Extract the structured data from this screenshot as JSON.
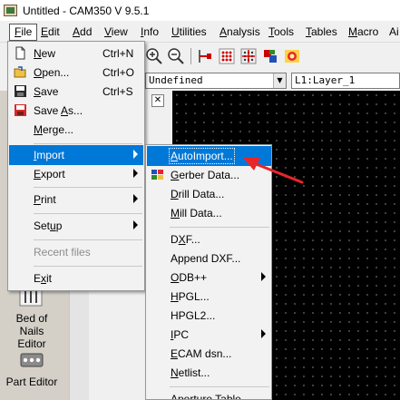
{
  "window": {
    "title": "Untitled - CAM350 V 9.5.1"
  },
  "menubar": {
    "items": [
      {
        "label": "File",
        "mnemonic": "F",
        "rest": "ile"
      },
      {
        "label": "Edit",
        "mnemonic": "E",
        "rest": "dit"
      },
      {
        "label": "Add",
        "mnemonic": "A",
        "rest": "dd"
      },
      {
        "label": "View",
        "mnemonic": "V",
        "rest": "iew"
      },
      {
        "label": "Info",
        "mnemonic": "I",
        "rest": "nfo"
      },
      {
        "label": "Utilities",
        "mnemonic": "U",
        "rest": "tilities"
      },
      {
        "label": "Analysis",
        "mnemonic": "A",
        "rest": "nalysis"
      },
      {
        "label": "Tools",
        "mnemonic": "T",
        "rest": "ools"
      },
      {
        "label": "Tables",
        "mnemonic": "T",
        "rest": "ables"
      },
      {
        "label": "Macro",
        "mnemonic": "M",
        "rest": "acro"
      },
      {
        "label": "Ai",
        "mnemonic": "",
        "rest": "Ai"
      }
    ]
  },
  "selectors": {
    "dcode": "Undefined",
    "layer": "L1:Layer_1"
  },
  "file_menu": {
    "items": [
      {
        "label_pre": "",
        "mnemonic": "N",
        "label_post": "ew",
        "shortcut": "Ctrl+N",
        "icon": "new-file-icon"
      },
      {
        "label_pre": "",
        "mnemonic": "O",
        "label_post": "pen...",
        "shortcut": "Ctrl+O",
        "icon": "open-folder-icon"
      },
      {
        "label_pre": "",
        "mnemonic": "S",
        "label_post": "ave",
        "shortcut": "Ctrl+S",
        "icon": "save-disk-icon"
      },
      {
        "label_pre": "Save ",
        "mnemonic": "A",
        "label_post": "s...",
        "shortcut": "",
        "icon": "save-as-icon"
      },
      {
        "label_pre": "",
        "mnemonic": "M",
        "label_post": "erge...",
        "shortcut": "",
        "icon": ""
      },
      {
        "label_pre": "",
        "mnemonic": "I",
        "label_post": "mport",
        "shortcut": "",
        "icon": ""
      },
      {
        "label_pre": "",
        "mnemonic": "E",
        "label_post": "xport",
        "shortcut": "",
        "icon": ""
      },
      {
        "label_pre": "",
        "mnemonic": "P",
        "label_post": "rint",
        "shortcut": "",
        "icon": ""
      },
      {
        "label_pre": "Set",
        "mnemonic": "u",
        "label_post": "p",
        "shortcut": "",
        "icon": ""
      },
      {
        "label_pre": "Recent files",
        "mnemonic": "",
        "label_post": "",
        "shortcut": "",
        "icon": ""
      },
      {
        "label_pre": "E",
        "mnemonic": "x",
        "label_post": "it",
        "shortcut": "",
        "icon": ""
      }
    ]
  },
  "import_menu": {
    "items": [
      {
        "label_pre": "",
        "mnemonic": "A",
        "label_post": "utoImport..."
      },
      {
        "label_pre": "",
        "mnemonic": "G",
        "label_post": "erber Data..."
      },
      {
        "label_pre": "",
        "mnemonic": "D",
        "label_post": "rill Data..."
      },
      {
        "label_pre": "",
        "mnemonic": "M",
        "label_post": "ill Data..."
      },
      {
        "label_pre": "D",
        "mnemonic": "X",
        "label_post": "F..."
      },
      {
        "label_pre": "Append DXF...",
        "mnemonic": "",
        "label_post": ""
      },
      {
        "label_pre": "",
        "mnemonic": "O",
        "label_post": "DB++"
      },
      {
        "label_pre": "",
        "mnemonic": "H",
        "label_post": "PGL..."
      },
      {
        "label_pre": "HPGL2...",
        "mnemonic": "",
        "label_post": ""
      },
      {
        "label_pre": "",
        "mnemonic": "I",
        "label_post": "PC"
      },
      {
        "label_pre": "",
        "mnemonic": "E",
        "label_post": "CAM dsn..."
      },
      {
        "label_pre": "",
        "mnemonic": "N",
        "label_post": "etlist..."
      },
      {
        "label_pre": "Aperture Table",
        "mnemonic": "",
        "label_post": ""
      }
    ]
  },
  "sidebar": {
    "tools": [
      {
        "label_line1": "Bed of Nails",
        "label_line2": "Editor"
      },
      {
        "label_line1": "Part Editor",
        "label_line2": ""
      }
    ]
  },
  "colors": {
    "highlight": "#0078d7",
    "annotation": "#e8262a",
    "canvas": "#000000"
  }
}
